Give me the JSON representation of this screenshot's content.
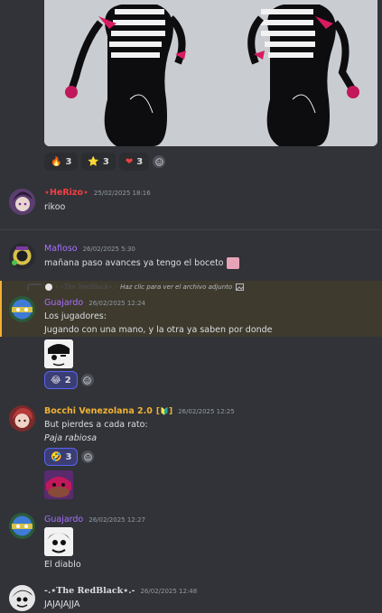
{
  "attachment": {
    "alt": "artwork attachment"
  },
  "reactions_top": [
    {
      "emoji": "🔥",
      "count": "3"
    },
    {
      "emoji": "⭐",
      "count": "3"
    },
    {
      "emoji": "❤",
      "count": "3"
    }
  ],
  "messages": [
    {
      "author": "⋆HeRizo⋆",
      "author_color": "#f23f43",
      "timestamp": "25/02/2025 18:16",
      "lines": [
        "rikoo"
      ]
    },
    {
      "author": "Mafioso",
      "author_color": "#a970ff",
      "timestamp": "26/02/2025 5:30",
      "lines": [
        "mañana paso avances ya tengo el boceto"
      ]
    },
    {
      "reply": {
        "author": "-.⋆The RedBlack⋆.-",
        "text": "Haz clic para ver el archivo adjunto"
      },
      "author": "Guajardo",
      "author_color": "#a970ff",
      "timestamp": "26/02/2025 12:24",
      "lines": [
        "Los jugadores:",
        "Jugando con una mano, y la otra ya saben por donde"
      ],
      "reactions": [
        {
          "emoji": "😂",
          "count": "2"
        }
      ]
    },
    {
      "author": "Bocchi Venezolana 2.0",
      "badge": "🔰",
      "author_color": "#f0b232",
      "timestamp": "26/02/2025 12:25",
      "lines": [
        "But pierdes a cada rato:",
        "Paja rabiosa"
      ],
      "reactions": [
        {
          "emoji": "🤣",
          "count": "3"
        }
      ]
    },
    {
      "author": "Guajardo",
      "author_color": "#a970ff",
      "timestamp": "26/02/2025 12:27",
      "lines": [
        "El diablo"
      ]
    },
    {
      "author": "-.⋆The RedBlack⋆.-",
      "author_color": "#dbdee1",
      "timestamp": "26/02/2025 12:48",
      "lines": [
        "JAJAJAJJA"
      ]
    }
  ]
}
